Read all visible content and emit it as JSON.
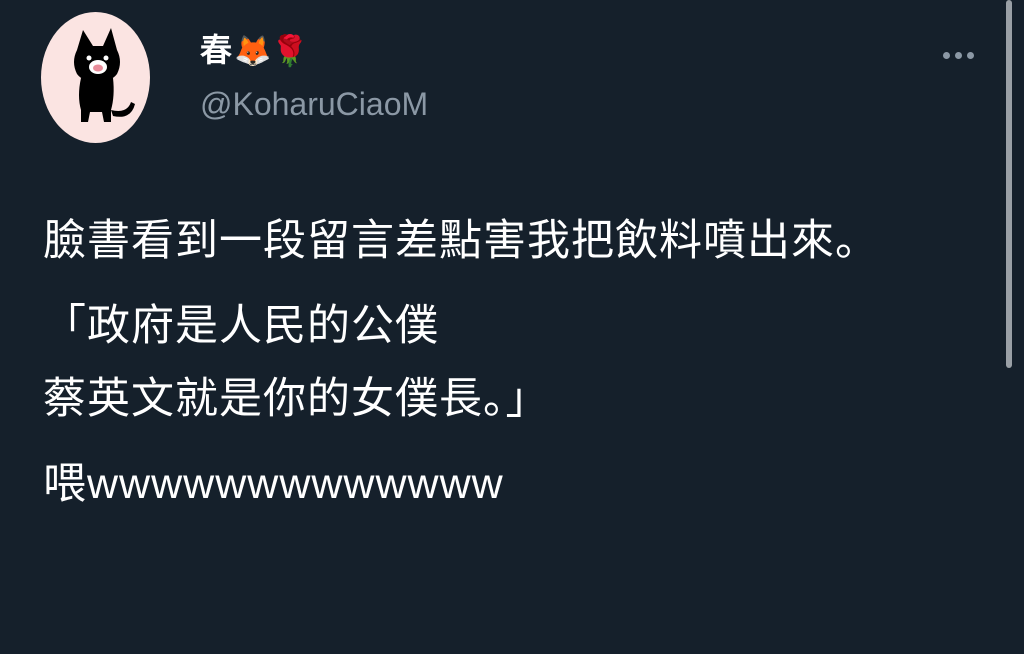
{
  "author": {
    "display_name": "春",
    "name_emojis": "🦊🌹",
    "handle": "@KoharuCiaoM"
  },
  "tweet": {
    "para1": "臉書看到一段留言差點害我把飲料噴出來。",
    "para2_line1": "「政府是人民的公僕",
    "para2_line2": "蔡英文就是你的女僕長。」",
    "para3_prefix": "喂",
    "para3_latin": "wwwwwwwwwwwww"
  },
  "icons": {
    "more": "more-horizontal-icon",
    "avatar": "black-cat-avatar"
  },
  "colors": {
    "background": "#15202b",
    "text": "#ffffff",
    "muted": "#8b98a5",
    "avatar_bg": "#fbe4e2"
  }
}
